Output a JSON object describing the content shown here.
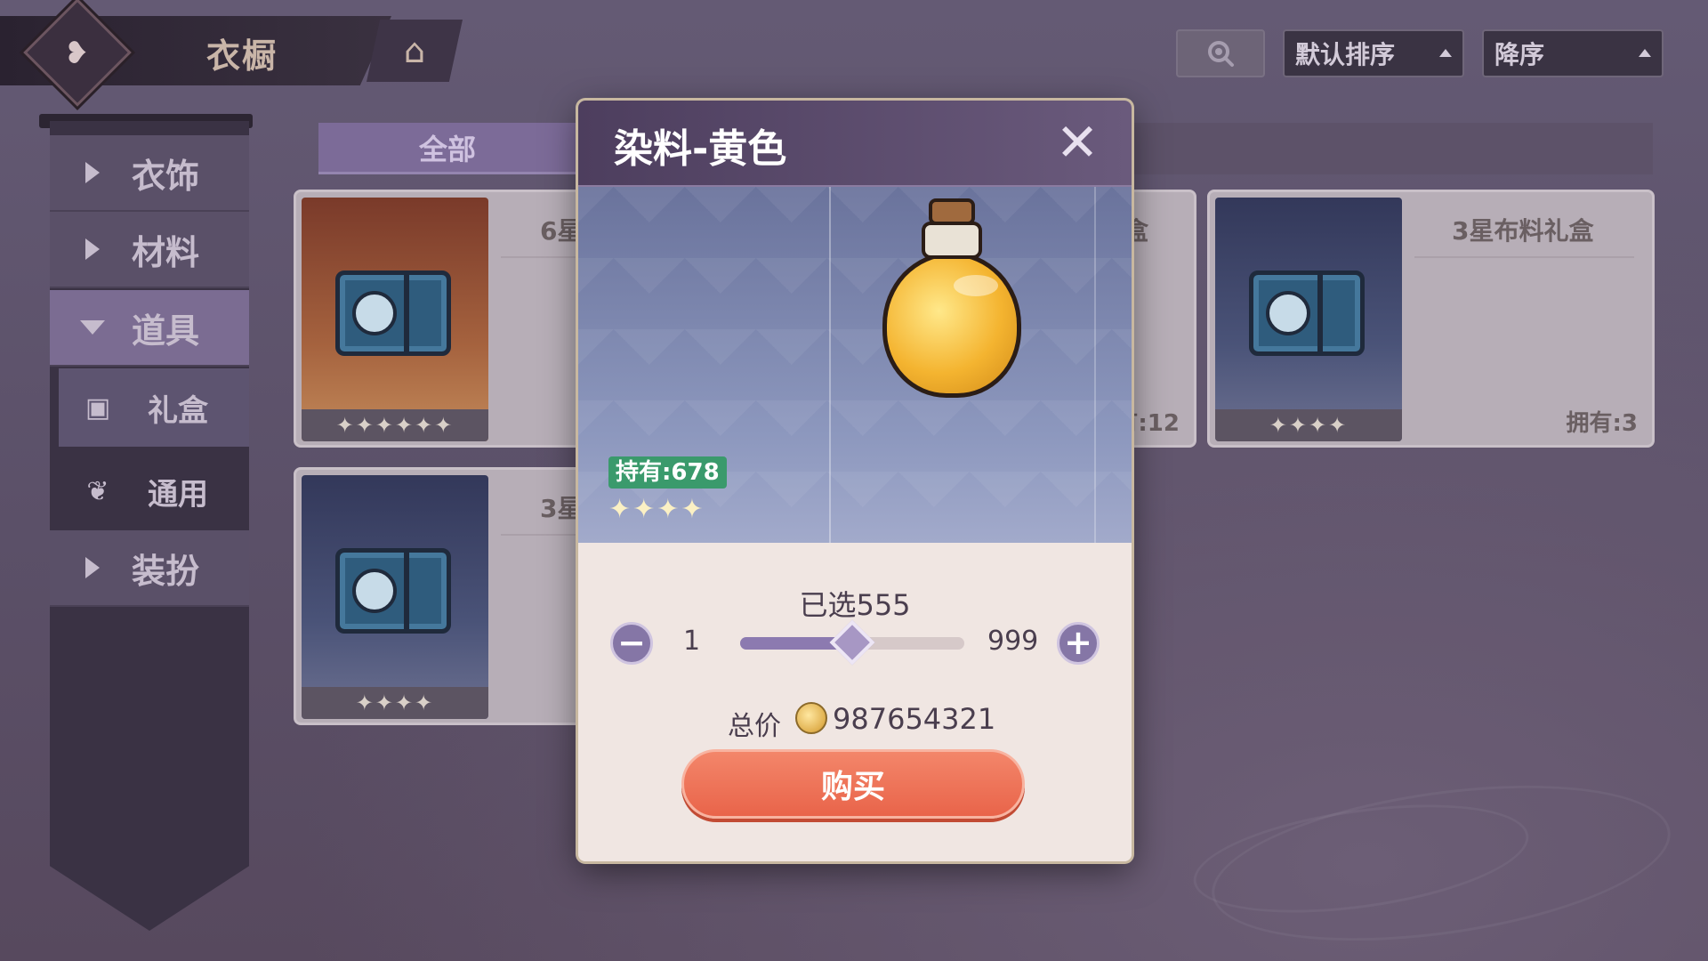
{
  "header": {
    "title": "衣橱",
    "emblem_icon": "heart-spade-icon",
    "home_icon": "home-icon"
  },
  "toolbar": {
    "search_icon": "search-icon",
    "sort_value": "默认排序",
    "order_value": "降序"
  },
  "sidebar": {
    "items": [
      {
        "label": "衣饰",
        "expanded": false
      },
      {
        "label": "材料",
        "expanded": false
      },
      {
        "label": "道具",
        "expanded": true
      },
      {
        "label": "装扮",
        "expanded": false
      }
    ],
    "subitems": [
      {
        "label": "礼盒",
        "icon": "gift-box-icon",
        "active": true
      },
      {
        "label": "通用",
        "icon": "leaf-cube-icon",
        "active": false
      }
    ]
  },
  "category_tab": {
    "label": "全部"
  },
  "cards": [
    {
      "name": "6星",
      "stars": "✦✦✦✦✦✦",
      "owned": ""
    },
    {
      "name": "盒",
      "stars": "",
      "owned": "有:12"
    },
    {
      "name": "3星布料礼盒",
      "stars": "✦✦✦✦",
      "owned": "拥有:3"
    },
    {
      "name": "3星",
      "stars": "✦✦✦✦",
      "owned": ""
    }
  ],
  "modal": {
    "title": "染料-黄色",
    "close_icon": "close-icon",
    "own_badge": "持有:678",
    "stars": "✦✦✦✦",
    "selected_text": "已选555",
    "qty_min": "1",
    "qty_max": "999",
    "slider_fraction": 0.5,
    "total_label": "总价",
    "total_value": "987654321",
    "coin_icon": "coin-icon",
    "buy_label": "购买"
  }
}
